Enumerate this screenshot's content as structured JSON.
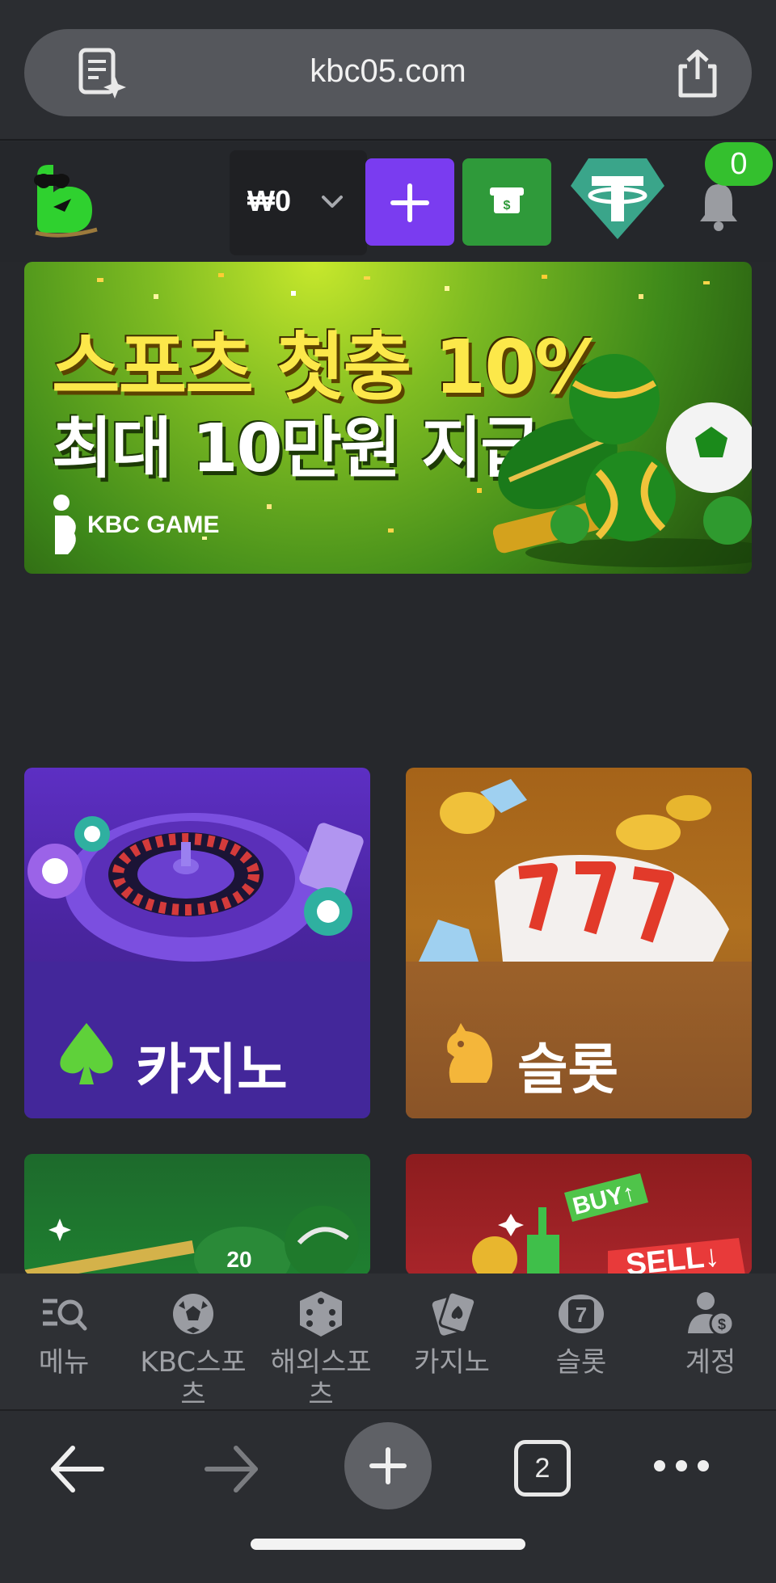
{
  "browser": {
    "url": "kbc05.com",
    "tab_count": "2"
  },
  "header": {
    "balance": "₩0",
    "notification_count": "0"
  },
  "banner": {
    "headline": "스포츠 첫충 10%",
    "subline": "최대 10만원 지급",
    "brand": "KBC GAME"
  },
  "cards": {
    "casino_label": "카지노",
    "slot_label": "슬롯"
  },
  "bottom_nav": {
    "items": [
      {
        "label": "메뉴",
        "icon": "menu-search-icon"
      },
      {
        "label": "KBC스포츠",
        "icon": "soccer-ball-icon"
      },
      {
        "label": "해외스포츠",
        "icon": "dice-icon"
      },
      {
        "label": "카지노",
        "icon": "cards-icon"
      },
      {
        "label": "슬롯",
        "icon": "slot-seven-icon"
      },
      {
        "label": "계정",
        "icon": "account-icon"
      }
    ]
  },
  "colors": {
    "plus_button": "#7a3cf0",
    "cash_button": "#2f9a3a",
    "badge": "#34c02e",
    "tether": "#3aa58a"
  }
}
